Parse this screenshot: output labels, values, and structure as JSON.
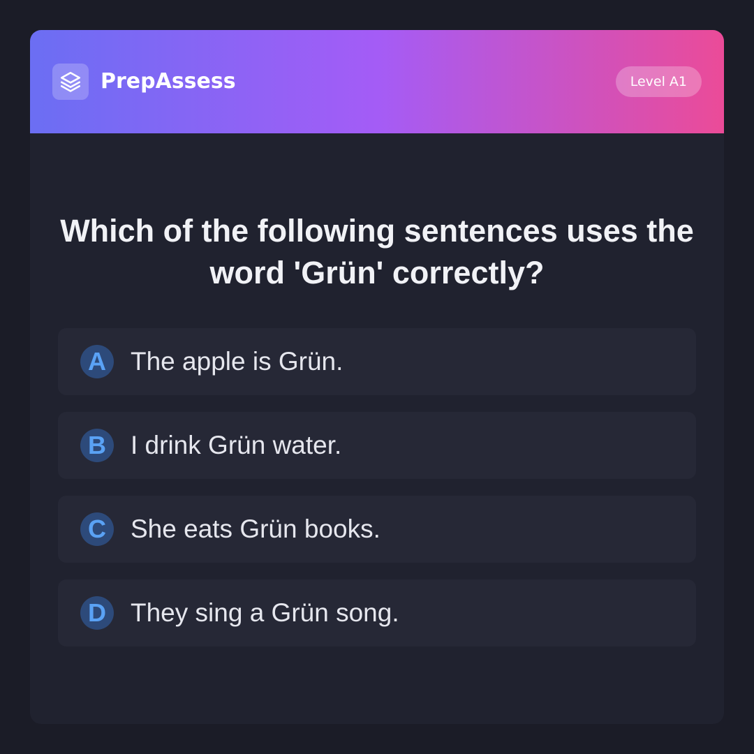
{
  "header": {
    "brand": "PrepAssess",
    "level": "Level A1",
    "logo_icon": "layers-icon"
  },
  "question": {
    "text": "Which of the following sentences uses the word 'Grün' correctly?"
  },
  "options": [
    {
      "letter": "A",
      "text": "The apple is Grün."
    },
    {
      "letter": "B",
      "text": "I drink Grün water."
    },
    {
      "letter": "C",
      "text": "She eats Grün books."
    },
    {
      "letter": "D",
      "text": "They sing a Grün song."
    }
  ],
  "colors": {
    "page_bg": "#1b1c27",
    "card_bg": "#20222f",
    "option_bg": "#262836",
    "gradient_start": "#6b6ef3",
    "gradient_mid": "#a45cf6",
    "gradient_end": "#eb4b98",
    "letter_bg": "#2d4a7a",
    "letter_fg": "#5aa2f5"
  }
}
